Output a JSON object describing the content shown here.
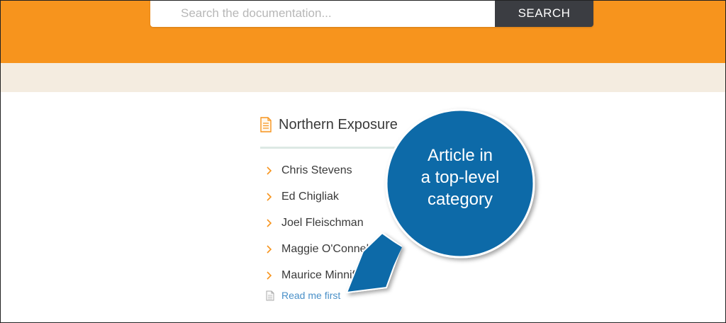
{
  "search": {
    "placeholder": "Search the documentation...",
    "button_label": "SEARCH"
  },
  "category": {
    "title": "Northern Exposure",
    "icon": "document-icon",
    "articles": [
      {
        "label": "Chris Stevens"
      },
      {
        "label": "Ed Chigliak"
      },
      {
        "label": "Joel Fleischman"
      },
      {
        "label": "Maggie O'Connell"
      },
      {
        "label": "Maurice Minnifield"
      }
    ],
    "read_first": "Read me first"
  },
  "callout": {
    "line1": "Article in",
    "line2": "a top-level",
    "line3": "category"
  },
  "colors": {
    "hero": "#f7941d",
    "band": "#f4ece0",
    "search_button": "#3b3d42",
    "callout": "#0f6aa8",
    "link": "#4a90c8"
  }
}
